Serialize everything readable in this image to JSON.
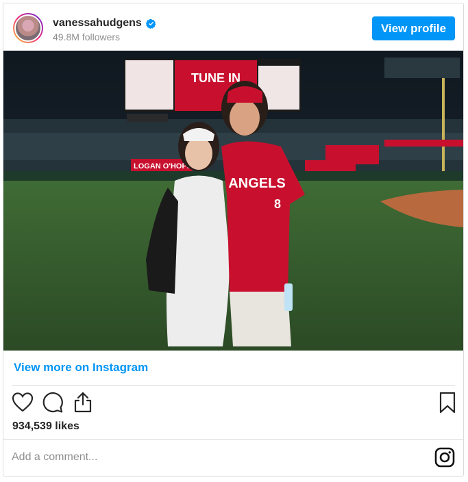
{
  "post": {
    "username": "vanessahudgens",
    "followers": "49.8M followers",
    "view_profile_label": "View profile",
    "view_more_label": "View more on Instagram",
    "likes": "934,539 likes",
    "comment_placeholder": "Add a comment..."
  },
  "photo": {
    "description_alt": "Photo of two people standing on a baseball field at night",
    "scoreboard_text": "TUNE IN",
    "jersey_text": "ANGELS",
    "jersey_number": "8",
    "banner_text": "LOGAN O'HOPPE"
  },
  "icons": {
    "verified": "verified-badge-icon",
    "like": "heart-icon",
    "comment": "comment-bubble-icon",
    "share": "share-icon",
    "save": "bookmark-icon",
    "instagram": "instagram-logo-icon"
  },
  "colors": {
    "accent": "#0095f6",
    "text": "#262626",
    "muted": "#8e8e8e",
    "border": "#dbdbdb"
  }
}
